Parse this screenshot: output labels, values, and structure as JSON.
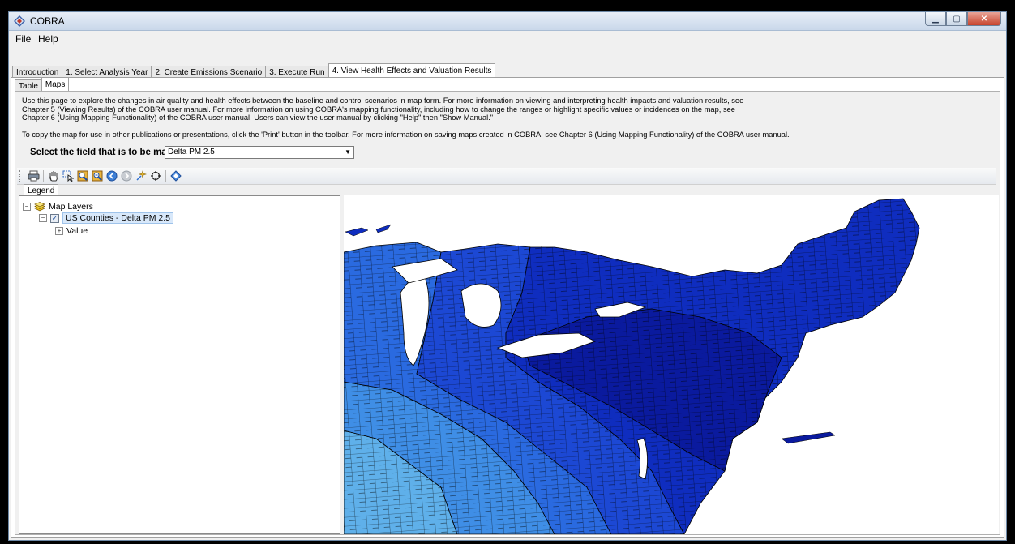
{
  "window": {
    "title": "COBRA",
    "controls": [
      "minimize",
      "maximize",
      "close"
    ]
  },
  "menu": {
    "items": [
      "File",
      "Help"
    ]
  },
  "main_tabs": [
    {
      "label": "Introduction",
      "active": false
    },
    {
      "label": "1. Select Analysis Year",
      "active": false
    },
    {
      "label": "2. Create Emissions Scenario",
      "active": false
    },
    {
      "label": "3. Execute Run",
      "active": false
    },
    {
      "label": "4. View Health Effects and Valuation Results",
      "active": true
    }
  ],
  "sub_tabs": [
    {
      "label": "Table",
      "active": false
    },
    {
      "label": "Maps",
      "active": true
    }
  ],
  "description": {
    "para1": "Use this page to explore the changes in air quality and health effects between the baseline and control scenarios in map form.  For more information on viewing and interpreting health impacts and valuation results, see Chapter 5 (Viewing Results) of the COBRA user manual.  For more information on using COBRA's mapping functionality, including how to change the ranges or highlight specific values or incidences on the map, see Chapter 6 (Using Mapping Functionality) of the COBRA user manual.  Users can view the user manual by clicking \"Help\" then \"Show Manual.\"",
    "para2": "To copy the map for use in other publications or presentations, click the 'Print' button in the toolbar.  For more information on saving maps created in COBRA, see Chapter 6 (Using Mapping Functionality) of the COBRA user manual."
  },
  "field_select": {
    "label": "Select the field that is to be mapped:",
    "value": "Delta PM 2.5"
  },
  "toolbar_icons": [
    "print-icon",
    "pan-icon",
    "select-icon",
    "zoom-in-icon",
    "zoom-out-icon",
    "back-icon",
    "forward-icon",
    "identify-icon",
    "full-extent-icon",
    "layer-icon"
  ],
  "legend": {
    "tab_label": "Legend",
    "root_label": "Map Layers",
    "layer_label": "US Counties - Delta PM 2.5",
    "layer_checked": true,
    "value_label": "Value"
  },
  "map": {
    "colors": {
      "darkest": "#0a1a9e",
      "dark": "#0f2dbf",
      "mid_dark": "#1c48d4",
      "mid": "#2a6ae0",
      "light": "#3f8ee6",
      "lightest": "#5fb0ea",
      "border": "#000000",
      "water": "#ffffff"
    }
  }
}
